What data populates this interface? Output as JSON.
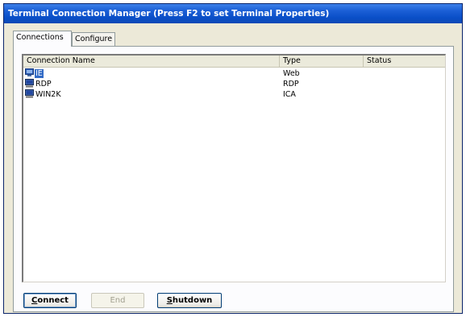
{
  "window": {
    "title": "Terminal Connection Manager (Press F2 to set Terminal Properties)"
  },
  "tabs": [
    {
      "label": "Connections",
      "active": true
    },
    {
      "label": "Configure",
      "active": false
    }
  ],
  "list": {
    "columns": [
      "Connection Name",
      "Type",
      "Status"
    ],
    "rows": [
      {
        "name": "IE",
        "type": "Web",
        "status": "",
        "icon": "web-connection-icon",
        "selected": true
      },
      {
        "name": "RDP",
        "type": "RDP",
        "status": "",
        "icon": "computer-icon",
        "selected": false
      },
      {
        "name": "WIN2K",
        "type": "ICA",
        "status": "",
        "icon": "computer-icon",
        "selected": false
      }
    ]
  },
  "buttons": {
    "connect": {
      "label": "Connect",
      "mnemonic": "C",
      "rest": "onnect"
    },
    "end": {
      "label": "End"
    },
    "shutdown": {
      "label": "Shutdown",
      "mnemonic": "S",
      "rest": "hutdown"
    }
  },
  "colors": {
    "titlebar": "#0a4fc8",
    "selection": "#316ac5",
    "window_bg": "#ece9d8"
  }
}
